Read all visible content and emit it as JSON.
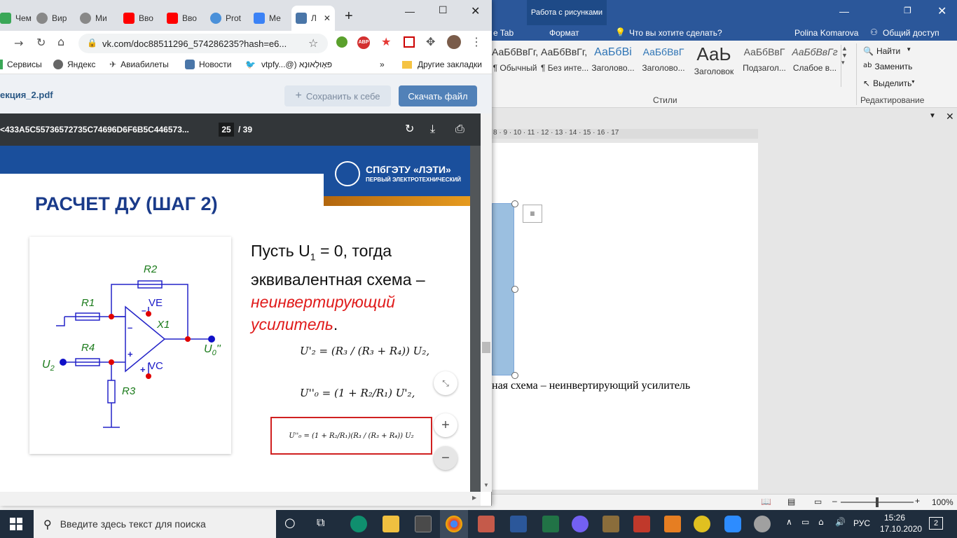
{
  "word": {
    "contextual_tab": "Работа с рисунками",
    "tabs": [
      "e Tab",
      "Формат"
    ],
    "tell_me": "Что вы хотите сделать?",
    "user": "Polina Komarova",
    "share": "Общий доступ",
    "styles": [
      {
        "sample": "АаБбВвГг,",
        "name": "¶ Обычный"
      },
      {
        "sample": "АаБбВвГг,",
        "name": "¶ Без инте..."
      },
      {
        "sample": "АаБбВі",
        "name": "Заголово..."
      },
      {
        "sample": "АаБбВвГ",
        "name": "Заголово..."
      },
      {
        "sample": "АаЬ",
        "name": "Заголовок"
      },
      {
        "sample": "АаБбВвГ",
        "name": "Подзагол..."
      },
      {
        "sample": "АаБбВвГг",
        "name": "Слабое в..."
      }
    ],
    "styles_group": "Стили",
    "editing": {
      "find": "Найти",
      "replace": "Заменить",
      "select": "Выделить",
      "group": "Редактирование"
    },
    "ruler_marks": "8 · 9 · 10 · 11 · 12 · 13 · 14 · 15 · 16 · 17",
    "page_text": "ная схема – неинвертирующий усилитель",
    "zoom": "100%"
  },
  "chrome": {
    "tabs": [
      "Чем",
      "Вир",
      "Ми",
      "Вво",
      "Вво",
      "Prot",
      "Ме",
      "Л"
    ],
    "new_tab": "+",
    "url": "vk.com/doc88511296_574286235?hash=e6...",
    "bookmarks": [
      "Сервисы",
      "Яндекс",
      "Авиабилеты",
      "Новости",
      "vtpfy...@) פּאָוּלְאוּנָא",
      "Другие закладки"
    ],
    "doc_name": "екция_2.pdf",
    "save_button": "Сохранить к себе",
    "download_button": "Скачать файл",
    "pdf_title": "<433A5C55736572735C74696D6F6B5C446573...",
    "page_current": "25",
    "page_total": "/ 39",
    "colors": {
      "accent": "#5181b8",
      "pdf_bar": "#323639"
    }
  },
  "slide": {
    "university": "СПбГЭТУ «ЛЭТИ»",
    "university_sub": "ПЕРВЫЙ ЭЛЕКТРОТЕХНИЧЕСКИЙ",
    "heading": "РАСЧЕТ ДУ (ШАГ 2)",
    "text_line1": "Пусть U",
    "text_line1_sub": "1",
    "text_line1_rest": " = 0, тогда",
    "text_line2": "эквивалентная схема –",
    "text_red1": "неинвертирующий",
    "text_red2": "усилитель",
    "text_dot": ".",
    "circuit": {
      "r1": "R1",
      "r2": "R2",
      "r3": "R3",
      "r4": "R4",
      "x1": "X1",
      "ve": "VE",
      "vc": "VC",
      "minus": "–",
      "plus": "+",
      "u2": "U",
      "u2_sub": "2",
      "u0": "U",
      "u0_sub": "0",
      "u0_prime": "''"
    },
    "formulas": [
      "U'₂ = (R₃ / (R₃ + R₄)) U₂,",
      "U''₀ = (1 + R₂/R₁) U'₂,",
      "U''₀ = (1 + R₂/R₁)(R₃ / (R₃ + R₄)) U₂"
    ]
  },
  "taskbar": {
    "search_placeholder": "Введите здесь текст для поиска",
    "language": "РУС",
    "time": "15:26",
    "date": "17.10.2020",
    "notifications": "2"
  }
}
